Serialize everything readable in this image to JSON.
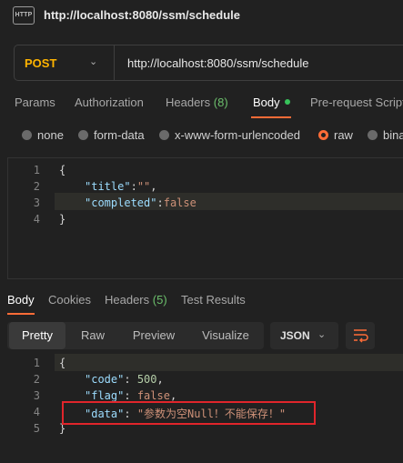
{
  "header": {
    "badge": "HTTP",
    "title": "http://localhost:8080/ssm/schedule"
  },
  "request": {
    "method": "POST",
    "method_color": "#ffb400",
    "url": "http://localhost:8080/ssm/schedule"
  },
  "request_tabs": [
    {
      "label": "Params"
    },
    {
      "label": "Authorization"
    },
    {
      "label": "Headers",
      "count": "(8)"
    },
    {
      "label": "Body",
      "active": true
    },
    {
      "label": "Pre-request Script"
    }
  ],
  "body_types": [
    {
      "label": "none"
    },
    {
      "label": "form-data"
    },
    {
      "label": "x-www-form-urlencoded"
    },
    {
      "label": "raw",
      "selected": true
    },
    {
      "label": "binary"
    }
  ],
  "request_body_lines": [
    {
      "num": "1",
      "text": "{"
    },
    {
      "num": "2",
      "text": "\"title\":\"\","
    },
    {
      "num": "3",
      "text": "\"completed\":false"
    },
    {
      "num": "4",
      "text": "}"
    }
  ],
  "response_tabs": [
    {
      "label": "Body",
      "active": true
    },
    {
      "label": "Cookies"
    },
    {
      "label": "Headers",
      "count": "(5)"
    },
    {
      "label": "Test Results"
    }
  ],
  "view_modes": [
    "Pretty",
    "Raw",
    "Preview",
    "Visualize"
  ],
  "format": "JSON",
  "response_body_lines": [
    {
      "num": "1",
      "text": "{"
    },
    {
      "num": "2",
      "text": "\"code\": 500,"
    },
    {
      "num": "3",
      "text": "\"flag\": false,"
    },
    {
      "num": "4",
      "text": "\"data\": \"参数为空Null！不能保存！\""
    },
    {
      "num": "5",
      "text": "}"
    }
  ],
  "colors": {
    "accent": "#ff6c37",
    "highlight_box": "#e0252b",
    "key": "#9cdcfe",
    "string": "#ce9178"
  }
}
